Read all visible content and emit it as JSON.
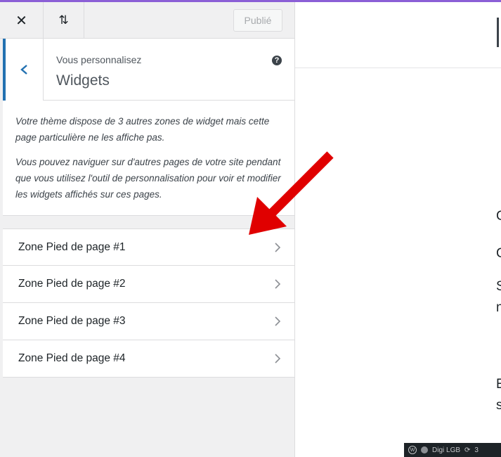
{
  "header": {
    "close_icon": "close-icon",
    "sort_icon": "arrows-up-down-icon",
    "publish_label": "Publié"
  },
  "section": {
    "sub_label": "Vous personnalisez",
    "title": "Widgets",
    "help_icon_text": "?"
  },
  "notice": {
    "paragraph1": "Votre thème dispose de 3 autres zones de widget mais cette page particulière ne les affiche pas.",
    "paragraph2": "Vous pouvez naviguer sur d'autres pages de votre site pendant que vous utilisez l'outil de personnalisation pour voir et modifier les widgets affichés sur ces pages."
  },
  "zones": [
    {
      "label": "Zone Pied de page #1"
    },
    {
      "label": "Zone Pied de page #2"
    },
    {
      "label": "Zone Pied de page #3"
    },
    {
      "label": "Zone Pied de page #4"
    }
  ],
  "preview": {
    "chars": [
      "C",
      "C",
      "S",
      "n",
      "E",
      "s"
    ],
    "adminbar": {
      "site_name": "Digi LGB",
      "update_count": "3"
    }
  },
  "colors": {
    "accent_blue": "#2271b1",
    "arrow_red": "#e00000",
    "top_accent": "#8b5fd6"
  }
}
